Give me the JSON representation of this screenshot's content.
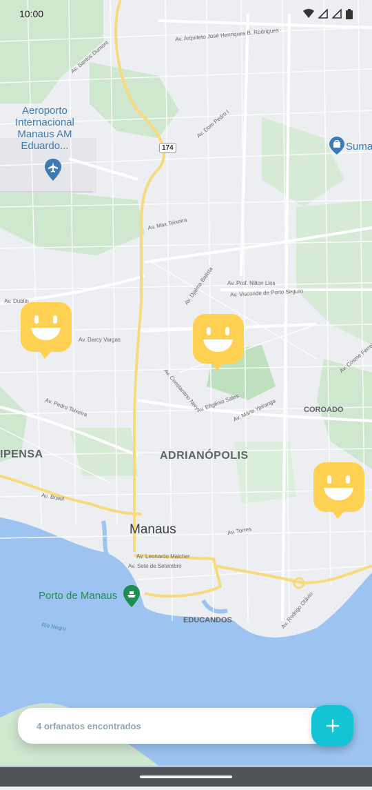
{
  "status_bar": {
    "time": "10:00",
    "icons": [
      "wifi-icon",
      "signal-icon",
      "signal-icon",
      "battery-icon"
    ]
  },
  "map": {
    "places": {
      "airport": [
        "Aeroporto",
        "Internacional",
        "Manaus AM",
        "Eduardo..."
      ],
      "store": "Suma",
      "port": "Porto de Manaus",
      "city": "Manaus",
      "districts": [
        "ADRIANÓPOLIS",
        "COROADO",
        "IPENSA",
        "EDUCANDOS"
      ],
      "water": "Rio Negro"
    },
    "highway_shield": "174",
    "roads": [
      "Av. Arquiteto José Henriques B. Rodrigues",
      "Av. Santos Dumont",
      "Av. Dom Pedro I",
      "Av. Djalma Batista",
      "Av. Prof. Nilton Lins",
      "Av. Max Teixeira",
      "Av. Constantino Nery",
      "Av. Darcy Vargas",
      "Av. Rodrigo Otávio",
      "Av. Leonardo Malcher",
      "Av. Sete de Setembro",
      "Av. Brasil",
      "Av. Efigênio Sales",
      "Av. Mário Ypiranga",
      "Av. Cosme Ferreira",
      "Av. Pedro Teixeira",
      "Av. Dublin",
      "Av. Torres",
      "Av. Visconde de Porto Seguro"
    ],
    "marker_icon": "smile-icon"
  },
  "footer": {
    "count_text": "4 orfanatos encontrados",
    "add_icon": "plus-icon"
  },
  "colors": {
    "marker": "#FFD152",
    "add_button": "#15C3D6",
    "footer_text": "#8FA7B2",
    "water": "#9DC4F0",
    "park": "#C8E3C7",
    "highway": "#F7DA7A"
  }
}
